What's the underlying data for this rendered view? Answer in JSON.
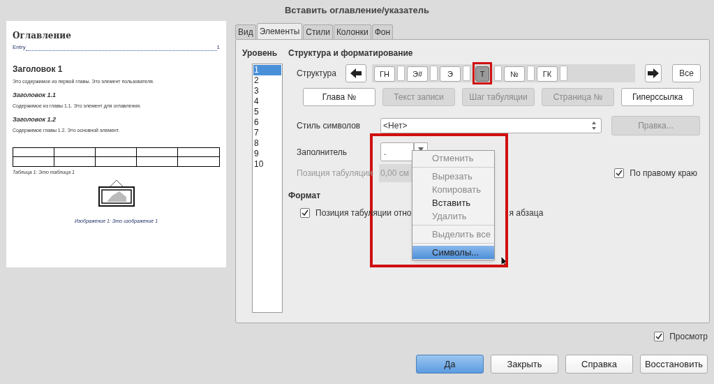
{
  "window": {
    "title": "Вставить оглавление/указатель"
  },
  "preview": {
    "title": "Оглавление",
    "entry": "Entry",
    "entry_page": "1",
    "heading1": "Заголовок 1",
    "text1": "Это содержимое из первой главы. Это элемент пользователя.",
    "heading11": "Заголовок 1.1",
    "text11": "Содержимое из главы 1.1. Это элемент для оглавления.",
    "heading12": "Заголовок 1.2",
    "text12": "Содержимое главы 1.2. Это основной элемент.",
    "table_caption": "Таблица 1: Это таблица 1",
    "image_caption": "Изображение 1: Это изображение 1"
  },
  "tabs": [
    {
      "label": "Вид",
      "selected": false
    },
    {
      "label": "Элементы",
      "selected": true
    },
    {
      "label": "Стили",
      "selected": false
    },
    {
      "label": "Колонки",
      "selected": false
    },
    {
      "label": "Фон",
      "selected": false
    }
  ],
  "level": {
    "heading": "Уровень",
    "items": [
      {
        "label": "1",
        "selected": true
      },
      {
        "label": "2",
        "selected": false
      },
      {
        "label": "3",
        "selected": false
      },
      {
        "label": "4",
        "selected": false
      },
      {
        "label": "5",
        "selected": false
      },
      {
        "label": "6",
        "selected": false
      },
      {
        "label": "7",
        "selected": false
      },
      {
        "label": "8",
        "selected": false
      },
      {
        "label": "9",
        "selected": false
      },
      {
        "label": "10",
        "selected": false
      }
    ]
  },
  "structure": {
    "heading": "Структура и форматирование",
    "label": "Структура",
    "tokens": [
      {
        "label": "ГН",
        "selected": false
      },
      {
        "label": "Э#",
        "selected": false
      },
      {
        "label": "Э",
        "selected": false
      },
      {
        "label": "Т",
        "selected": true
      },
      {
        "label": "№",
        "selected": false
      },
      {
        "label": "ГК",
        "selected": false
      }
    ],
    "all_button": "Все"
  },
  "insert_buttons": [
    {
      "label": "Глава №",
      "disabled": false
    },
    {
      "label": "Текст записи",
      "disabled": true
    },
    {
      "label": "Шаг табуляции",
      "disabled": true
    },
    {
      "label": "Страница №",
      "disabled": true
    },
    {
      "label": "Гиперссылка",
      "disabled": false
    }
  ],
  "char_style": {
    "label": "Стиль символов",
    "value": "<Нет>",
    "edit_button": "Правка...",
    "edit_disabled": true
  },
  "fill": {
    "label": "Заполнитель",
    "value": "."
  },
  "tab_position": {
    "label": "Позиция табуляции",
    "value": "0,00 см",
    "disabled": true
  },
  "align_right": {
    "label": "По правому краю",
    "checked": true
  },
  "format": {
    "heading": "Формат",
    "checkbox_checked": true,
    "label_before": "Позиция табуляции отно",
    "label_after": "я абзаца"
  },
  "context_menu": [
    {
      "kind": "item",
      "label": "Отменить",
      "disabled": true,
      "selected": false
    },
    {
      "kind": "separator"
    },
    {
      "kind": "item",
      "label": "Вырезать",
      "disabled": true,
      "selected": false
    },
    {
      "kind": "item",
      "label": "Копировать",
      "disabled": true,
      "selected": false
    },
    {
      "kind": "item",
      "label": "Вставить",
      "disabled": false,
      "selected": false
    },
    {
      "kind": "item",
      "label": "Удалить",
      "disabled": true,
      "selected": false
    },
    {
      "kind": "separator"
    },
    {
      "kind": "item",
      "label": "Выделить все",
      "disabled": true,
      "selected": false
    },
    {
      "kind": "separator"
    },
    {
      "kind": "item",
      "label": "Символы...",
      "disabled": false,
      "selected": true
    }
  ],
  "preview_toggle": {
    "label": "Просмотр",
    "checked": true
  },
  "buttons": [
    {
      "label": "Да",
      "default": true
    },
    {
      "label": "Закрыть",
      "default": false
    },
    {
      "label": "Справка",
      "default": false
    },
    {
      "label": "Восстановить",
      "default": false
    }
  ]
}
